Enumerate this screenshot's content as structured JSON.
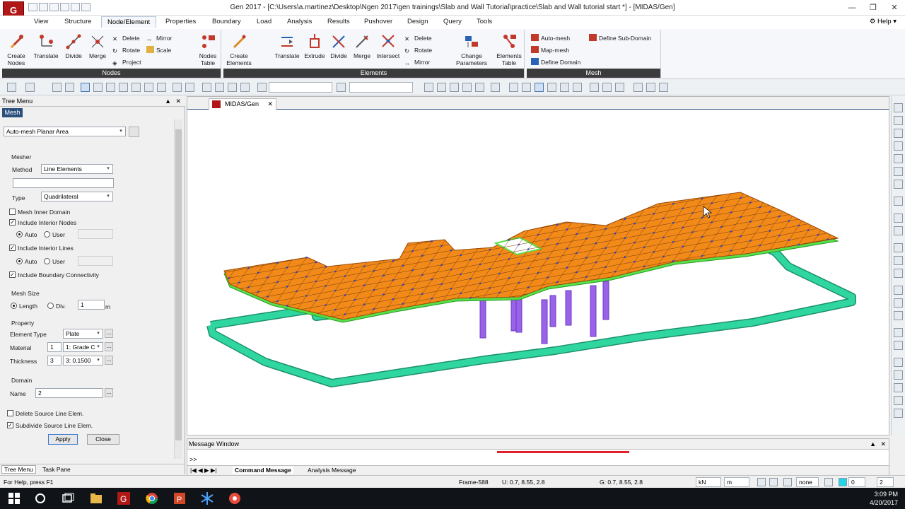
{
  "window": {
    "title": "Gen 2017 - [C:\\Users\\a.martinez\\Desktop\\Ngen 2017\\gen trainings\\Slab and Wall Tutorial\\practice\\Slab and Wall tutorial start *] - [MIDAS/Gen]",
    "logo_text": "G"
  },
  "tabs": [
    "View",
    "Structure",
    "Node/Element",
    "Properties",
    "Boundary",
    "Load",
    "Analysis",
    "Results",
    "Pushover",
    "Design",
    "Query",
    "Tools"
  ],
  "active_tab": "Node/Element",
  "help_label": "Help",
  "ribbon": {
    "nodes_group": {
      "label": "Nodes",
      "create_nodes": "Create Nodes",
      "translate": "Translate",
      "divide": "Divide",
      "merge": "Merge",
      "delete": "Delete",
      "rotate": "Rotate",
      "project": "Project",
      "mirror": "Mirror",
      "scale": "Scale",
      "nodes_table": "Nodes Table"
    },
    "elements_group": {
      "label": "Elements",
      "create_elements": "Create Elements",
      "translate": "Translate",
      "extrude": "Extrude",
      "divide": "Divide",
      "merge": "Merge",
      "intersect": "Intersect",
      "delete": "Delete",
      "rotate": "Rotate",
      "mirror": "Mirror",
      "change_parameters": "Change Parameters",
      "elements_table": "Elements Table"
    },
    "mesh_group": {
      "label": "Mesh",
      "auto_mesh": "Auto-mesh",
      "map_mesh": "Map-mesh",
      "define_domain": "Define Domain",
      "define_sub_domain": "Define Sub-Domain"
    }
  },
  "tree_menu": {
    "title": "Tree Menu",
    "tab": "Mesh",
    "function_select": "Auto-mesh Planar Area",
    "mesher_label": "Mesher",
    "method_label": "Method",
    "method_value": "Line Elements",
    "type_label": "Type",
    "type_value": "Quadrilateral",
    "mesh_inner_domain": "Mesh Inner Domain",
    "include_interior_nodes": "Include Interior Nodes",
    "auto_label": "Auto",
    "user_label": "User",
    "include_interior_lines": "Include Interior Lines",
    "include_boundary_connectivity": "Include Boundary Connectivity",
    "mesh_size_label": "Mesh Size",
    "length_label": "Length",
    "div_label": "Div.",
    "mesh_size_value": "1",
    "mesh_size_unit": "m",
    "property_label": "Property",
    "element_type_label": "Element Type",
    "element_type_value": "Plate",
    "material_label": "Material",
    "material_id": "1",
    "material_value": "1: Grade C",
    "thickness_label": "Thickness",
    "thickness_id": "3",
    "thickness_value": "3: 0.1500",
    "domain_label": "Domain",
    "name_label": "Name",
    "name_value": "2",
    "delete_source": "Delete Source Line Elem.",
    "subdivide_source": "Subdivide Source Line Elem.",
    "apply_label": "Apply",
    "close_label": "Close",
    "bottom_tab_tree": "Tree Menu",
    "bottom_tab_task": "Task Pane"
  },
  "document_tab": "MIDAS/Gen",
  "message_window": {
    "title": "Message Window",
    "prompt": ">>",
    "tab_command": "Command Message",
    "tab_analysis": "Analysis Message"
  },
  "status": {
    "help_text": "For Help, press F1",
    "frame": "Frame-588",
    "ucs": "U: 0.7, 8.55, 2.8",
    "gcs": "G: 0.7, 8.55, 2.8",
    "force_unit": "kN",
    "length_unit": "m",
    "none_value": "none",
    "page_value": "0",
    "page_total": "2"
  },
  "taskbar": {
    "time": "3:09 PM",
    "date": "4/20/2017"
  },
  "colors": {
    "slab": "#f28a1a",
    "slab_edge": "#57e048",
    "beam": "#2fd6a0",
    "column": "#9a62e8",
    "node": "#3040c0",
    "accent": "#2b4f7d"
  }
}
